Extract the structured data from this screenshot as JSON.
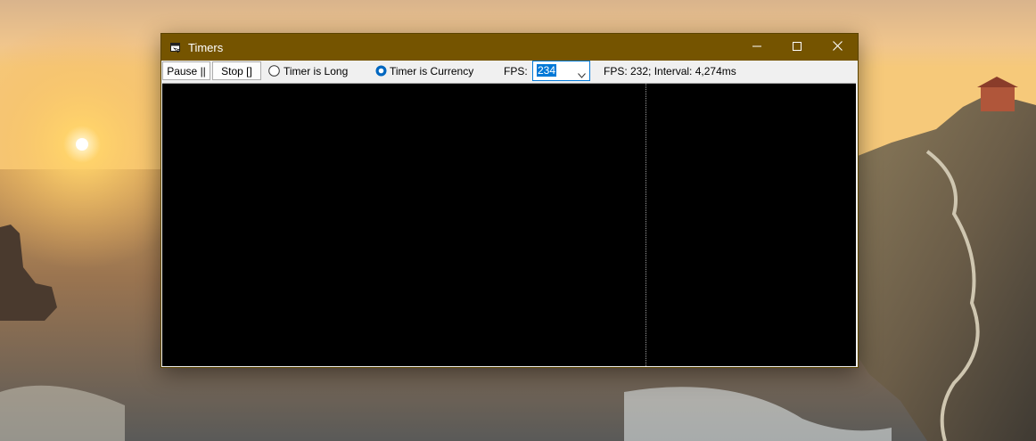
{
  "window": {
    "title": "Timers",
    "icons": {
      "app": "window-app-icon",
      "minimize": "minimize-icon",
      "maximize": "maximize-icon",
      "close": "close-icon"
    }
  },
  "toolbar": {
    "pause_label": "Pause ||",
    "stop_label": "Stop []",
    "radio_long_label": "Timer is Long",
    "radio_long_checked": false,
    "radio_currency_label": "Timer is Currency",
    "radio_currency_checked": true,
    "fps_label": "FPS:",
    "fps_value": "234",
    "status_text": "FPS: 232; Interval: 4,274ms"
  },
  "colors": {
    "titlebar": "#755400",
    "canvas": "#000000",
    "accent": "#0078d7"
  }
}
